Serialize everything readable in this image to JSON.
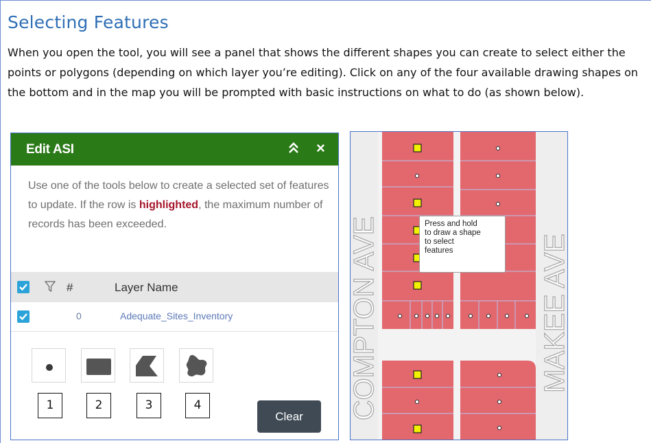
{
  "doc": {
    "heading": "Selecting Features",
    "paragraph": "When you open the tool, you will see a panel that shows the different shapes you can create to select either the points or polygons (depending on which layer you’re editing).   Click on any of the four available drawing shapes on the bottom and in the map you will be prompted with basic instructions on what to do (as shown below)."
  },
  "widget": {
    "title": "Edit ASI",
    "close_glyph": "×",
    "description_before": "Use one of the tools below to create a selected set of features to update. If the row is ",
    "description_highlight": "highlighted",
    "description_after": ", the maximum number of records has been exceeded.",
    "table": {
      "header_count": "#",
      "header_layer": "Layer Name",
      "rows": [
        {
          "count": "0",
          "layer_name": "Adequate_Sites_Inventory"
        }
      ]
    },
    "tools": [
      {
        "icon": "point-icon",
        "number": "1"
      },
      {
        "icon": "rectangle-icon",
        "number": "2"
      },
      {
        "icon": "polygon-icon",
        "number": "3"
      },
      {
        "icon": "freehand-icon",
        "number": "4"
      }
    ],
    "clear_label": "Clear",
    "colors": {
      "header": "#2b7a18",
      "highlight": "#a4142a",
      "checkbox": "#2ba3d9",
      "clear_button": "#3f4a55"
    }
  },
  "map": {
    "street_left": "COMPTON AVE",
    "street_right": "MAKEE AVE",
    "tooltip_lines": [
      "Press and hold",
      "to draw a shape",
      "to select",
      "features"
    ],
    "colors": {
      "parcel": "#e2686e",
      "point": "#f2f200"
    }
  }
}
